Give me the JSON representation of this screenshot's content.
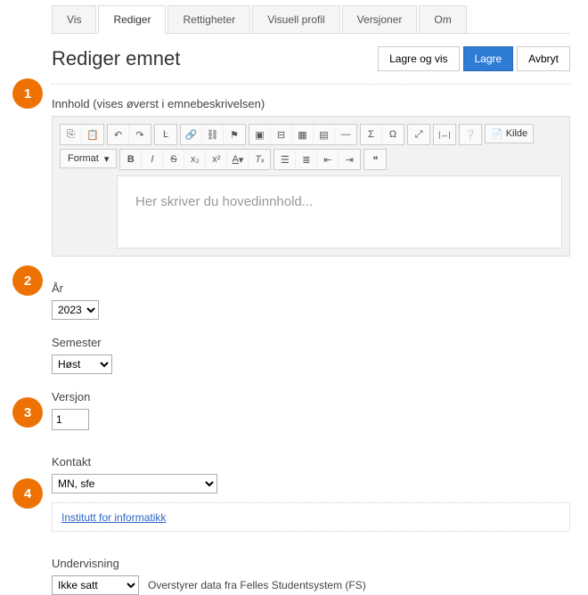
{
  "tabs": {
    "vis": "Vis",
    "rediger": "Rediger",
    "rettigheter": "Rettigheter",
    "visuell": "Visuell profil",
    "versjoner": "Versjoner",
    "om": "Om"
  },
  "title": "Rediger emnet",
  "actions": {
    "lagre_og_vis": "Lagre og vis",
    "lagre": "Lagre",
    "avbryt": "Avbryt"
  },
  "innhold": {
    "label": "Innhold (vises øverst i emnebeskrivelsen)",
    "format": "Format",
    "source": "Kilde",
    "placeholder": "Her skriver du hovedinnhold..."
  },
  "ar": {
    "label": "År",
    "value": "2023"
  },
  "semester": {
    "label": "Semester",
    "value": "Høst"
  },
  "versjon": {
    "label": "Versjon",
    "value": "1"
  },
  "kontakt": {
    "label": "Kontakt",
    "value": "MN, sfe",
    "link": "Institutt for informatikk"
  },
  "undervisning": {
    "label": "Undervisning",
    "value": "Ikke satt",
    "helper": "Overstyrer data fra Felles Studentsystem (FS)"
  },
  "badges": {
    "b1": "1",
    "b2": "2",
    "b3": "3",
    "b4": "4"
  }
}
